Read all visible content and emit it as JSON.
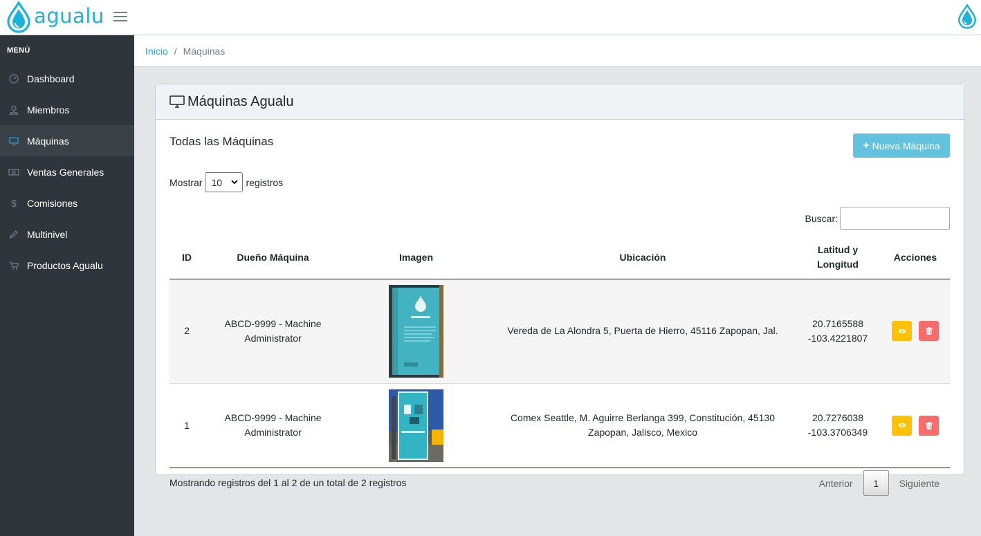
{
  "header": {
    "brand_name": "agualu"
  },
  "sidebar": {
    "title": "MENÚ",
    "items": [
      {
        "label": "Dashboard",
        "icon": "speedometer-icon"
      },
      {
        "label": "Miembros",
        "icon": "user-icon"
      },
      {
        "label": "Máquinas",
        "icon": "monitor-icon",
        "active": true
      },
      {
        "label": "Ventas Generales",
        "icon": "money-icon"
      },
      {
        "label": "Comisiones",
        "icon": "dollar-icon"
      },
      {
        "label": "Multinivel",
        "icon": "pencil-icon"
      },
      {
        "label": "Productos Agualu",
        "icon": "cart-icon"
      }
    ]
  },
  "breadcrumb": {
    "home": "Inicio",
    "separator": "/",
    "current": "Máquinas"
  },
  "card": {
    "title": "Máquinas Agualu",
    "subtitle": "Todas las Máquinas",
    "new_button": "Nueva Máquina",
    "length_prefix": "Mostrar",
    "length_value": "10",
    "length_suffix": "registros",
    "search_label": "Buscar:",
    "search_value": ""
  },
  "table": {
    "columns": [
      "ID",
      "Dueño Máquina",
      "Imagen",
      "Ubicación",
      "Latitud y Longitud",
      "Acciones"
    ],
    "rows": [
      {
        "id": "2",
        "owner_line1": "ABCD-9999 - Machine",
        "owner_line2": "Administrator",
        "location_line1": "Vereda de La Alondra 5, Puerta de Hierro, 45116 Zapopan, Jal.",
        "location_line2": "",
        "lat": "20.7165588",
        "lng": "-103.4221807"
      },
      {
        "id": "1",
        "owner_line1": "ABCD-9999 - Machine",
        "owner_line2": "Administrator",
        "location_line1": "Comex Seattle, M. Aguirre Berlanga 399, Constitución, 45130",
        "location_line2": "Zapopan, Jalisco, Mexico",
        "lat": "20.7276038",
        "lng": "-103.3706349"
      }
    ]
  },
  "footer": {
    "info": "Mostrando registros del 1 al 2 de un total de 2 registros",
    "prev": "Anterior",
    "page": "1",
    "next": "Siguiente"
  },
  "colors": {
    "brand": "#1ab3dd",
    "sidebar_bg": "#2f353a",
    "info_button": "#63c2de",
    "warning": "#ffc107",
    "danger": "#f86c6b"
  }
}
